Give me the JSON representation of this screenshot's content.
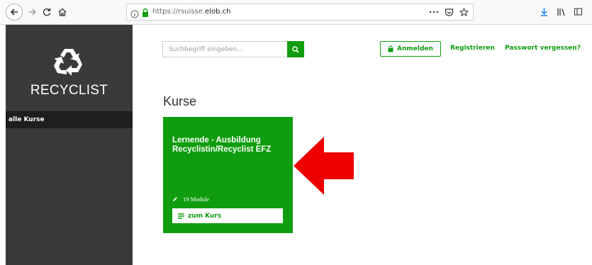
{
  "browser": {
    "url_prefix": "https://rsuisse.",
    "url_domain": "elob.ch",
    "icons": [
      "back-icon",
      "forward-icon",
      "reload-icon",
      "home-icon",
      "info-icon",
      "lock-icon",
      "page-actions-icon",
      "pocket-icon",
      "bookmark-star-icon",
      "download-icon",
      "library-icon",
      "sidebar-icon"
    ]
  },
  "sidebar": {
    "logo_text": "RECYCLIST",
    "nav_items": [
      {
        "label": "alle Kurse"
      }
    ]
  },
  "header": {
    "search_placeholder": "Suchbegriff eingeben...",
    "login_label": "Anmelden",
    "register_label": "Registrieren",
    "forgot_password_label": "Passwort vergessen?"
  },
  "main": {
    "title": "Kurse",
    "courses": [
      {
        "title": "Lernende - Ausbildung Recyclistin/Recyclist EFZ",
        "modules": "19 Module",
        "button_label": "zum Kurs"
      }
    ]
  },
  "colors": {
    "brand_green": "#0f9d0f",
    "sidebar_bg": "#3a3a3a",
    "sidebar_active_bg": "#1e1e1e",
    "annotation_red": "#ee0000"
  }
}
